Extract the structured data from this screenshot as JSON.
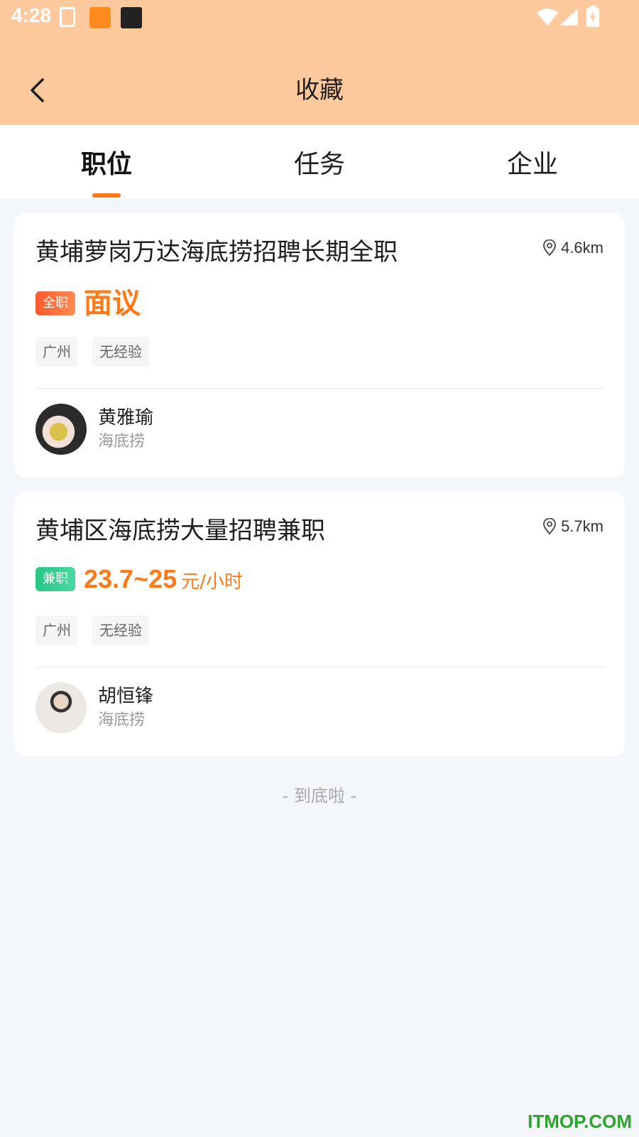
{
  "status_bar": {
    "time": "4:28"
  },
  "header": {
    "title": "收藏"
  },
  "tabs": [
    {
      "label": "职位",
      "active": true
    },
    {
      "label": "任务",
      "active": false
    },
    {
      "label": "企业",
      "active": false
    }
  ],
  "jobs": [
    {
      "title": "黄埔萝岗万达海底捞招聘长期全职",
      "distance": "4.6km",
      "type_badge": "全职",
      "salary": "面议",
      "tags": [
        "广州",
        "无经验"
      ],
      "recruiter": {
        "name": "黄雅瑜",
        "company": "海底捞"
      }
    },
    {
      "title": "黄埔区海底捞大量招聘兼职",
      "distance": "5.7km",
      "type_badge": "兼职",
      "salary": "23.7~25",
      "salary_unit": "元/小时",
      "tags": [
        "广州",
        "无经验"
      ],
      "recruiter": {
        "name": "胡恒锋",
        "company": "海底捞"
      }
    }
  ],
  "footer": {
    "end_text": "- 到底啦 -"
  },
  "watermark": "ITMOP.COM",
  "colors": {
    "header_bg": "#ffc99e",
    "accent": "#ff7a16",
    "full_time_badge": "#ff5a2a",
    "part_time_badge": "#28c684"
  }
}
